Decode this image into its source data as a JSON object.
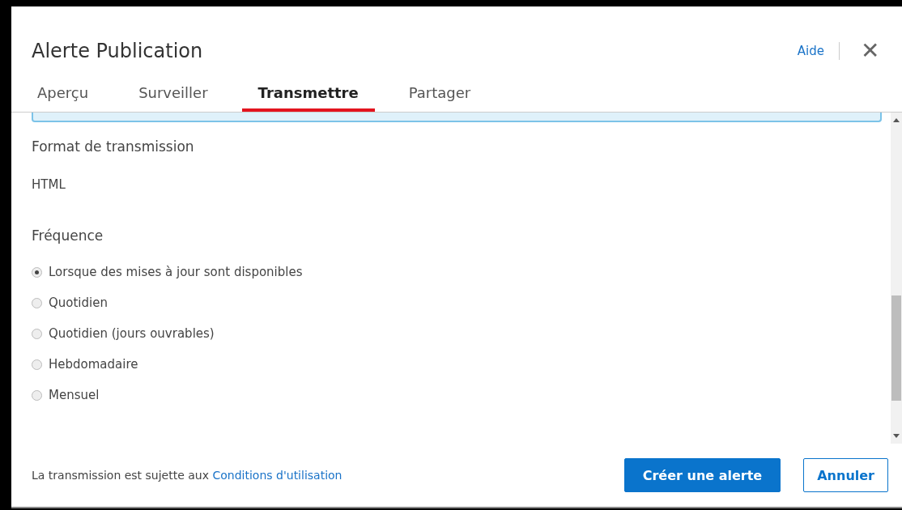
{
  "dialog": {
    "title": "Alerte Publication",
    "help_link": "Aide",
    "close_symbol": "✕"
  },
  "tabs": [
    {
      "label": "Aperçu",
      "selected": false
    },
    {
      "label": "Surveiller",
      "selected": false
    },
    {
      "label": "Transmettre",
      "selected": true
    },
    {
      "label": "Partager",
      "selected": false
    }
  ],
  "format": {
    "label": "Format de transmission",
    "value": "HTML"
  },
  "frequency": {
    "label": "Fréquence",
    "options": [
      {
        "label": "Lorsque des mises à jour sont disponibles",
        "selected": true
      },
      {
        "label": "Quotidien",
        "selected": false
      },
      {
        "label": "Quotidien (jours ouvrables)",
        "selected": false
      },
      {
        "label": "Hebdomadaire",
        "selected": false
      },
      {
        "label": "Mensuel",
        "selected": false
      }
    ]
  },
  "footer": {
    "note": "La transmission est sujette aux",
    "terms_link": "Conditions d'utilisation",
    "buttons": [
      {
        "label": "Créer une alerte",
        "kind": "primary"
      },
      {
        "label": "Annuler",
        "kind": "secondary"
      }
    ]
  }
}
